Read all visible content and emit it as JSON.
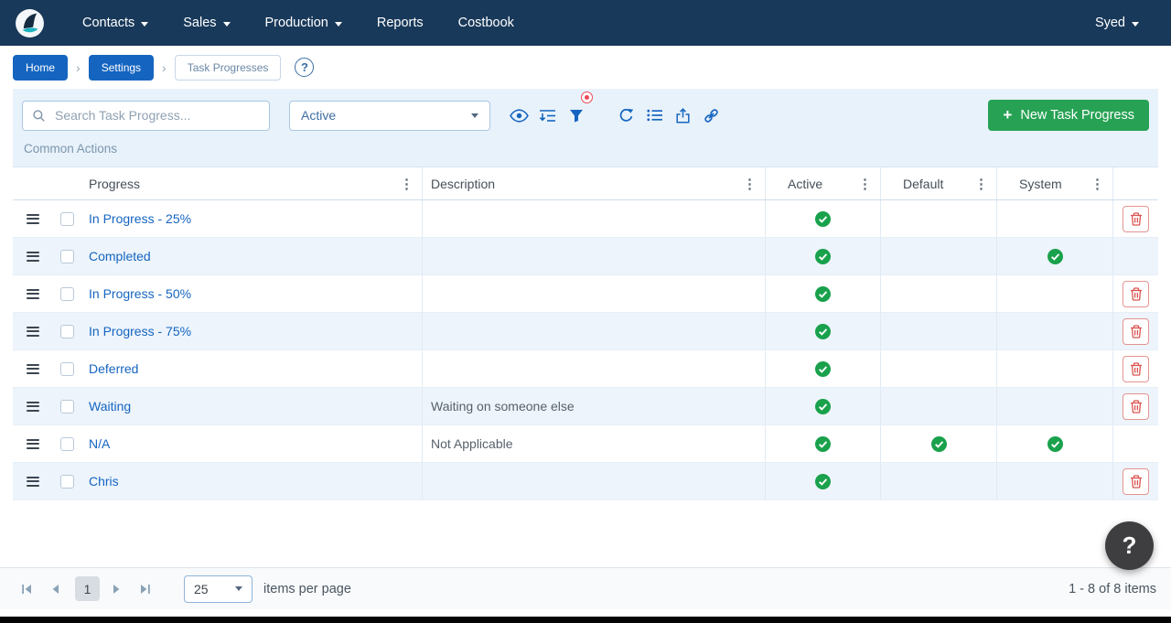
{
  "colors": {
    "navbar_bg": "#19395a",
    "link_blue": "#1565c0",
    "accent_green": "#27a254",
    "check_green": "#19a14c",
    "danger_red": "#d9534f",
    "toolbar_bg": "#e8f2fb"
  },
  "navbar": {
    "items": [
      {
        "label": "Contacts",
        "dropdown": true
      },
      {
        "label": "Sales",
        "dropdown": true
      },
      {
        "label": "Production",
        "dropdown": true
      },
      {
        "label": "Reports",
        "dropdown": false
      },
      {
        "label": "Costbook",
        "dropdown": false
      }
    ],
    "user": "Syed"
  },
  "breadcrumb": {
    "separator": "›",
    "items": [
      {
        "label": "Home"
      },
      {
        "label": "Settings"
      },
      {
        "label": "Task Progresses"
      }
    ],
    "help_icon": "?"
  },
  "toolbar": {
    "search_placeholder": "Search Task Progress...",
    "filter_dropdown_value": "Active",
    "new_button_plus": "+",
    "new_button_label": "New Task Progress",
    "common_actions_label": "Common Actions"
  },
  "icons": {
    "kebab": "⋮"
  },
  "table": {
    "columns": [
      "Progress",
      "Description",
      "Active",
      "Default",
      "System"
    ],
    "rows": [
      {
        "progress": "In Progress - 25%",
        "description": "",
        "active": true,
        "default": false,
        "system": false,
        "deletable": true
      },
      {
        "progress": "Completed",
        "description": "",
        "active": true,
        "default": false,
        "system": true,
        "deletable": false
      },
      {
        "progress": "In Progress - 50%",
        "description": "",
        "active": true,
        "default": false,
        "system": false,
        "deletable": true
      },
      {
        "progress": "In Progress - 75%",
        "description": "",
        "active": true,
        "default": false,
        "system": false,
        "deletable": true
      },
      {
        "progress": "Deferred",
        "description": "",
        "active": true,
        "default": false,
        "system": false,
        "deletable": true
      },
      {
        "progress": "Waiting",
        "description": "Waiting on someone else",
        "active": true,
        "default": false,
        "system": false,
        "deletable": true
      },
      {
        "progress": "N/A",
        "description": "Not Applicable",
        "active": true,
        "default": true,
        "system": true,
        "deletable": false
      },
      {
        "progress": "Chris",
        "description": "",
        "active": true,
        "default": false,
        "system": false,
        "deletable": true
      }
    ]
  },
  "pagination": {
    "current_page": "1",
    "page_size": "25",
    "items_per_page_label": "items per page",
    "range_label": "1 - 8 of 8 items"
  },
  "help": {
    "floating_label": "?"
  }
}
